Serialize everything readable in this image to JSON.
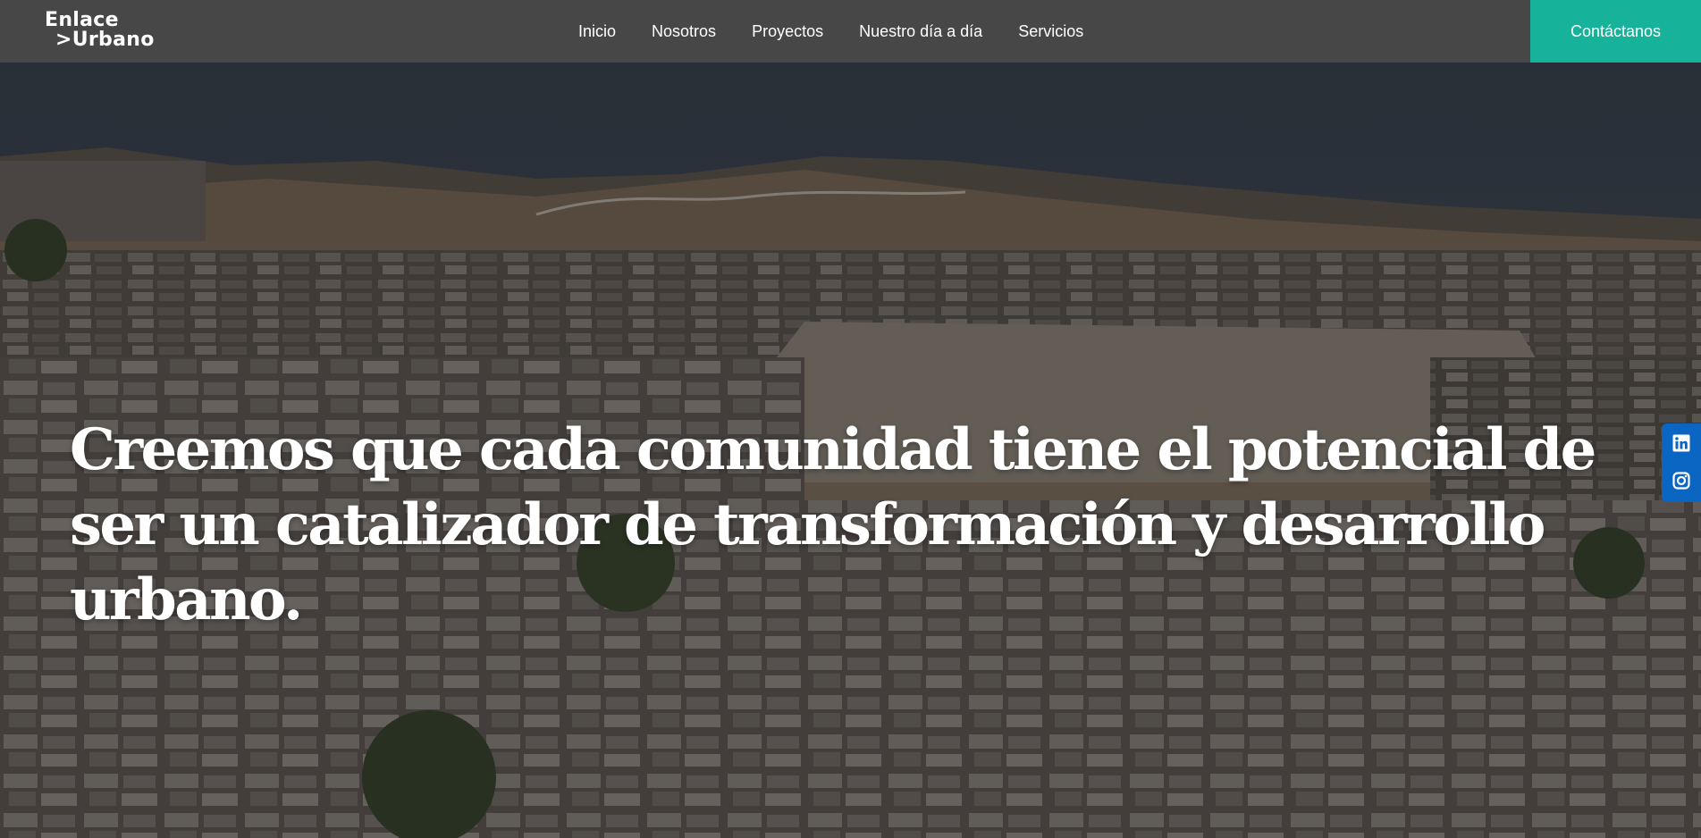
{
  "header": {
    "logo_line1": "Enlace",
    "logo_line2": ">Urbano",
    "nav_items": [
      {
        "label": "Inicio"
      },
      {
        "label": "Nosotros"
      },
      {
        "label": "Proyectos"
      },
      {
        "label": "Nuestro día a día"
      },
      {
        "label": "Servicios"
      }
    ],
    "cta_label": "Contáctanos"
  },
  "hero": {
    "headline": "Creemos que cada comunidad tiene el potencial de ser un catalizador de transformación y desarrollo urbano.",
    "background_icon": "aerial-city-photo"
  },
  "social": {
    "items": [
      {
        "icon": "linkedin-icon"
      },
      {
        "icon": "instagram-icon"
      }
    ]
  },
  "colors": {
    "navbar_bg": "#474747",
    "cta_bg": "#16b39a",
    "social_bg": "#0a66c2"
  }
}
